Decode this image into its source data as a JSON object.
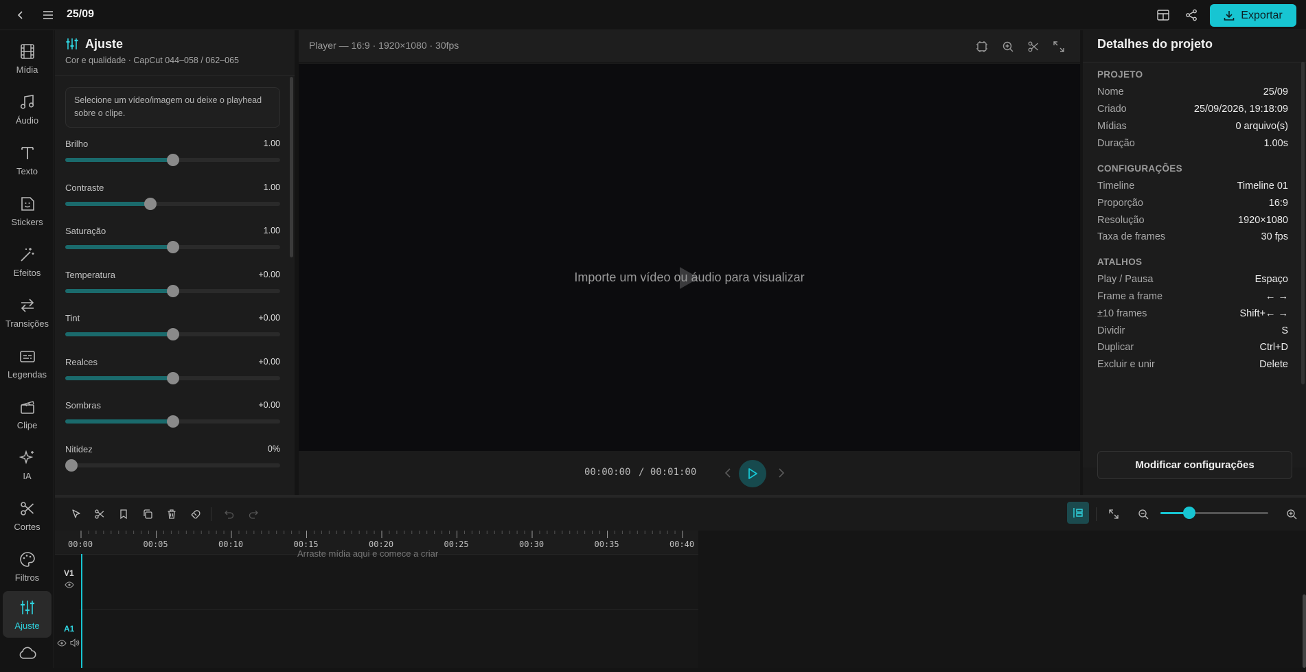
{
  "header": {
    "title": "25/09",
    "export_label": "Exportar"
  },
  "colors": {
    "accent": "#17c5d2",
    "slider_fill": "#1a6a6c",
    "background": "#141414"
  },
  "rail": [
    {
      "label": "Mídia",
      "icon": "film-icon"
    },
    {
      "label": "Áudio",
      "icon": "music-note-icon"
    },
    {
      "label": "Texto",
      "icon": "text-icon"
    },
    {
      "label": "Stickers",
      "icon": "sticker-icon"
    },
    {
      "label": "Efeitos",
      "icon": "magic-wand-icon"
    },
    {
      "label": "Transições",
      "icon": "arrows-swap-icon"
    },
    {
      "label": "Legendas",
      "icon": "captions-icon"
    },
    {
      "label": "Clipe",
      "icon": "clapperboard-icon"
    },
    {
      "label": "IA",
      "icon": "sparkles-icon"
    },
    {
      "label": "Cortes",
      "icon": "scissors-icon"
    },
    {
      "label": "Filtros",
      "icon": "palette-icon"
    },
    {
      "label": "Ajuste",
      "icon": "sliders-icon",
      "active": true
    }
  ],
  "adjust": {
    "title": "Ajuste",
    "subtitle": "Cor e qualidade · CapCut 044–058 / 062–065",
    "hint": "Selecione um vídeo/imagem ou deixe o playhead sobre o clipe.",
    "sliders": [
      {
        "label": "Brilho",
        "value": "1.00",
        "level": 0.5
      },
      {
        "label": "Contraste",
        "value": "1.00",
        "level": 0.39
      },
      {
        "label": "Saturação",
        "value": "1.00",
        "level": 0.5
      },
      {
        "label": "Temperatura",
        "value": "+0.00",
        "level": 0.5
      },
      {
        "label": "Tint",
        "value": "+0.00",
        "level": 0.5
      },
      {
        "label": "Realces",
        "value": "+0.00",
        "level": 0.5
      },
      {
        "label": "Sombras",
        "value": "+0.00",
        "level": 0.5
      },
      {
        "label": "Nitidez",
        "value": "0%",
        "level": 0.0
      }
    ]
  },
  "player": {
    "info": "Player — 16:9 · 1920×1080 · 30fps",
    "empty_message": "Importe um vídeo ou áudio para visualizar",
    "time_current": "00:00:00",
    "time_total": "/ 00:01:00"
  },
  "details": {
    "title": "Detalhes do projeto",
    "sections": [
      {
        "title": "PROJETO",
        "rows": [
          {
            "key": "Nome",
            "value": "25/09"
          },
          {
            "key": "Criado",
            "value": "25/09/2026, 19:18:09"
          },
          {
            "key": "Mídias",
            "value": "0 arquivo(s)"
          },
          {
            "key": "Duração",
            "value": "1.00s"
          }
        ]
      },
      {
        "title": "CONFIGURAÇÕES",
        "rows": [
          {
            "key": "Timeline",
            "value": "Timeline 01"
          },
          {
            "key": "Proporção",
            "value": "16:9"
          },
          {
            "key": "Resolução",
            "value": "1920×1080"
          },
          {
            "key": "Taxa de frames",
            "value": "30 fps"
          }
        ]
      },
      {
        "title": "ATALHOS",
        "rows": [
          {
            "key": "Play / Pausa",
            "value": "Espaço"
          },
          {
            "key": "Frame a frame",
            "value": "← →"
          },
          {
            "key": "±10 frames",
            "value": "Shift+← →"
          },
          {
            "key": "Dividir",
            "value": "S"
          },
          {
            "key": "Duplicar",
            "value": "Ctrl+D"
          },
          {
            "key": "Excluir e unir",
            "value": "Delete"
          }
        ]
      }
    ],
    "modify_label": "Modificar configurações"
  },
  "timeline": {
    "ticks": [
      "00:00",
      "00:05",
      "00:10",
      "00:15",
      "00:20",
      "00:25",
      "00:30",
      "00:35",
      "00:40"
    ],
    "drop_hint": "Arraste mídia aqui e comece a criar",
    "tracks": [
      {
        "label": "V1"
      },
      {
        "label": "A1"
      }
    ],
    "zoom_level": 0.27
  }
}
